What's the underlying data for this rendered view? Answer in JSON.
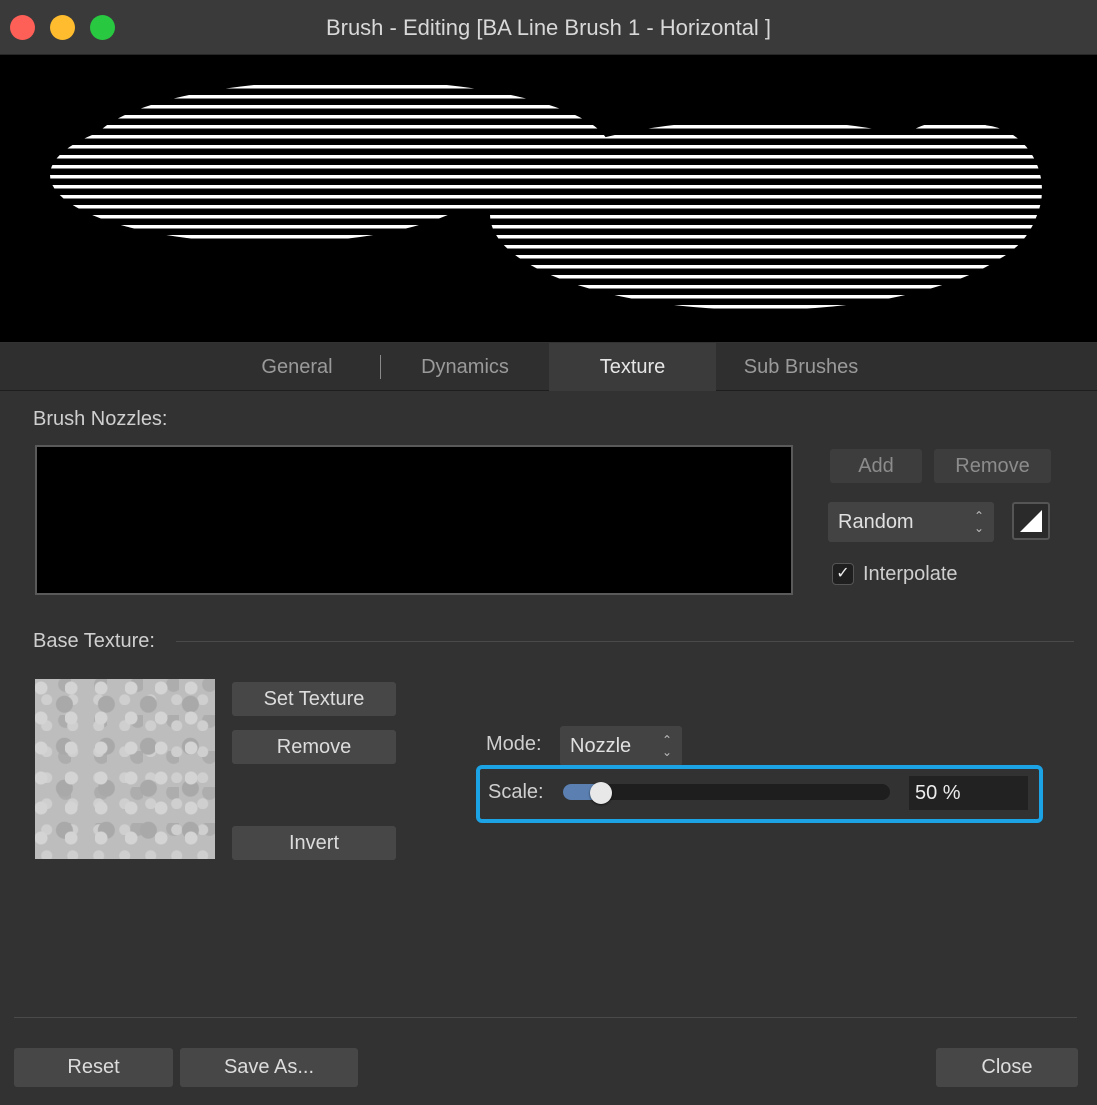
{
  "window": {
    "title": "Brush - Editing [BA Line Brush 1 - Horizontal ]"
  },
  "tabs": [
    {
      "label": "General",
      "active": false
    },
    {
      "label": "Dynamics",
      "active": false
    },
    {
      "label": "Texture",
      "active": true
    },
    {
      "label": "Sub Brushes",
      "active": false
    }
  ],
  "nozzles": {
    "heading": "Brush Nozzles:",
    "add_label": "Add",
    "remove_label": "Remove",
    "order_value": "Random",
    "interpolate_label": "Interpolate",
    "interpolate_checked": true
  },
  "base_texture": {
    "heading": "Base Texture:",
    "set_texture_label": "Set Texture",
    "remove_label": "Remove",
    "invert_label": "Invert",
    "mode_label": "Mode:",
    "mode_value": "Nozzle",
    "scale_label": "Scale:",
    "scale_value": "50 %",
    "scale_fraction": 0.06
  },
  "footer": {
    "reset_label": "Reset",
    "save_as_label": "Save As...",
    "close_label": "Close"
  },
  "colors": {
    "highlight": "#1ba3e6",
    "close": "#fe5f57",
    "minimize": "#febc2e",
    "zoom": "#28c840"
  }
}
